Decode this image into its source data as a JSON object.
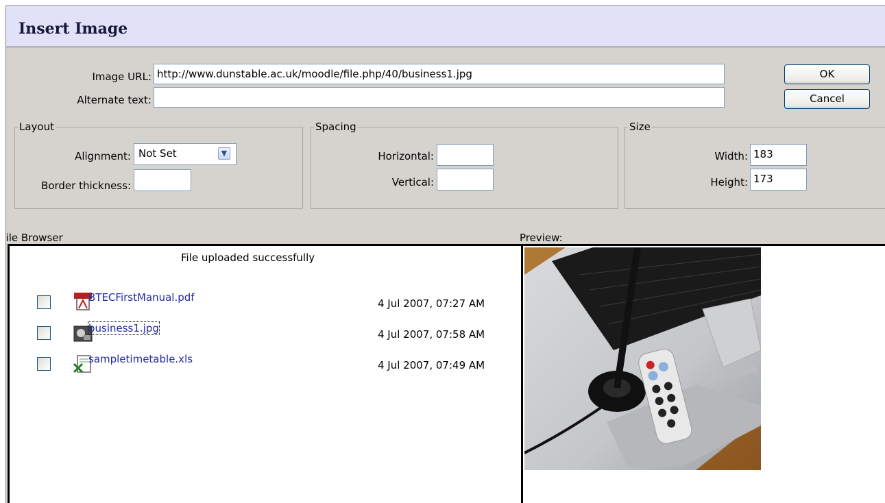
{
  "dialog": {
    "title": "Insert Image"
  },
  "image_url": {
    "label": "Image URL:",
    "value": "http://www.dunstable.ac.uk/moodle/file.php/40/business1.jpg"
  },
  "alt_text": {
    "label": "Alternate text:",
    "value": ""
  },
  "buttons": {
    "ok": "OK",
    "cancel": "Cancel"
  },
  "layout": {
    "legend": "Layout",
    "alignment_label": "Alignment:",
    "alignment_value": "Not Set",
    "border_label": "Border thickness:",
    "border_value": ""
  },
  "spacing": {
    "legend": "Spacing",
    "horizontal_label": "Horizontal:",
    "horizontal_value": "",
    "vertical_label": "Vertical:",
    "vertical_value": ""
  },
  "size": {
    "legend": "Size",
    "width_label": "Width:",
    "width_value": "183",
    "height_label": "Height:",
    "height_value": "173"
  },
  "file_browser": {
    "label": "File Browser",
    "status": "File uploaded successfully",
    "files": [
      {
        "name": "BTECFirstManual.pdf",
        "date": "4 Jul 2007, 07:27 AM",
        "icon": "pdf-file-icon"
      },
      {
        "name": "business1.jpg",
        "date": "4 Jul 2007, 07:58 AM",
        "icon": "image-file-icon"
      },
      {
        "name": "sampletimetable.xls",
        "date": "4 Jul 2007, 07:49 AM",
        "icon": "excel-file-icon"
      }
    ]
  },
  "preview": {
    "label": "Preview:"
  }
}
